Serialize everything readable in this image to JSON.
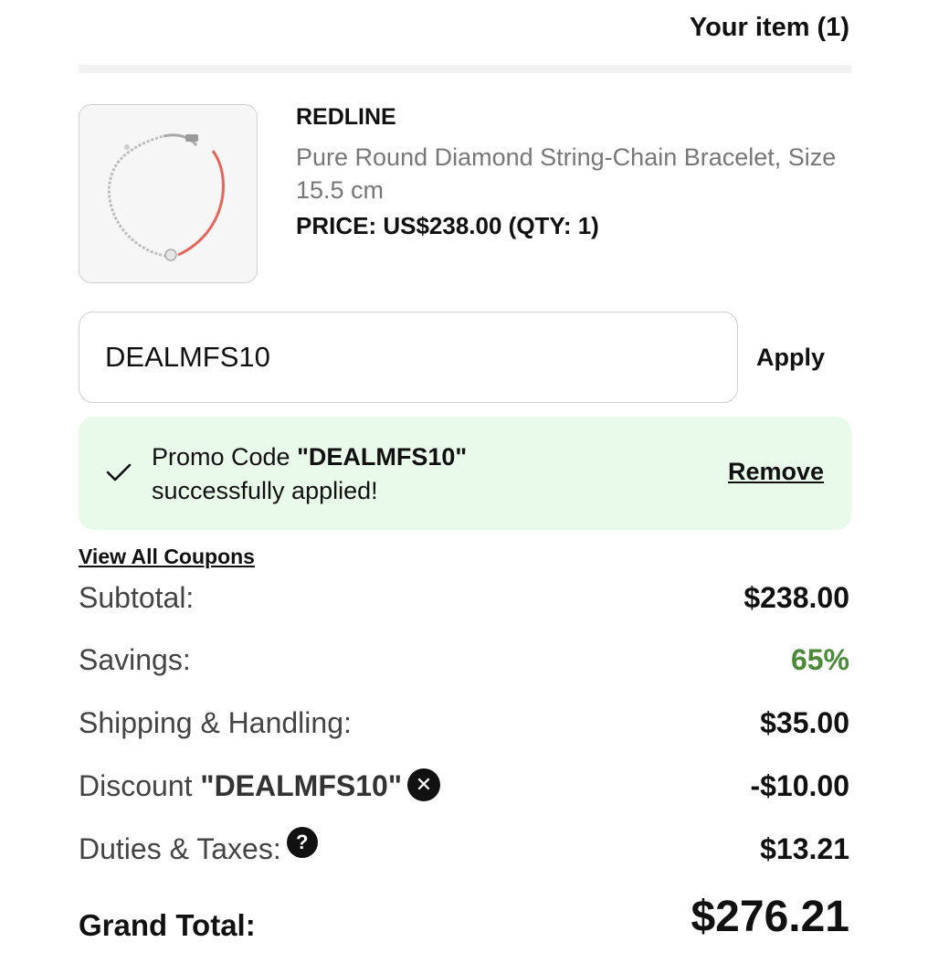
{
  "header": {
    "title": "Your item (1)"
  },
  "item": {
    "brand": "REDLINE",
    "name": "Pure Round Diamond String-Chain Bracelet, Size 15.5 cm",
    "price_line": "PRICE: US$238.00 (QTY: 1)",
    "image_icon": "bracelet-image"
  },
  "promo": {
    "input_value": "DEALMFS10",
    "apply_label": "Apply",
    "success_prefix": "Promo Code ",
    "success_code": "\"DEALMFS10\"",
    "success_suffix": "successfully applied!",
    "remove_label": "Remove",
    "success_color": "#eafaea"
  },
  "coupons_link": "View All Coupons",
  "summary": {
    "subtotal_label": "Subtotal:",
    "subtotal_value": "$238.00",
    "savings_label": "Savings:",
    "savings_value": "65%",
    "savings_color": "#4c8a3a",
    "shipping_label": "Shipping & Handling:",
    "shipping_value": "$35.00",
    "discount_label": "Discount ",
    "discount_code": "\"DEALMFS10\"",
    "discount_value": "-$10.00",
    "taxes_label": "Duties & Taxes:",
    "taxes_value": "$13.21",
    "grand_label": "Grand Total:",
    "grand_value": "$276.21"
  }
}
